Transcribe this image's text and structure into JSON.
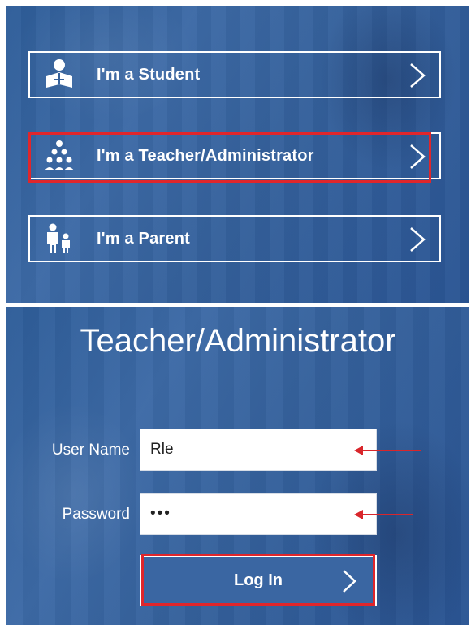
{
  "roles": [
    {
      "label": "I'm a Student",
      "icon": "student-icon"
    },
    {
      "label": "I'm a Teacher/Administrator",
      "icon": "teacher-group-icon"
    },
    {
      "label": "I'm a Parent",
      "icon": "parent-child-icon"
    }
  ],
  "login": {
    "title": "Teacher/Administrator",
    "username_label": "User Name",
    "username_value": "Rle",
    "password_label": "Password",
    "password_value": "•••",
    "submit_label": "Log In"
  },
  "colors": {
    "panel_blue": "#35619c",
    "highlight_red": "#e0262b",
    "text_white": "#ffffff"
  }
}
